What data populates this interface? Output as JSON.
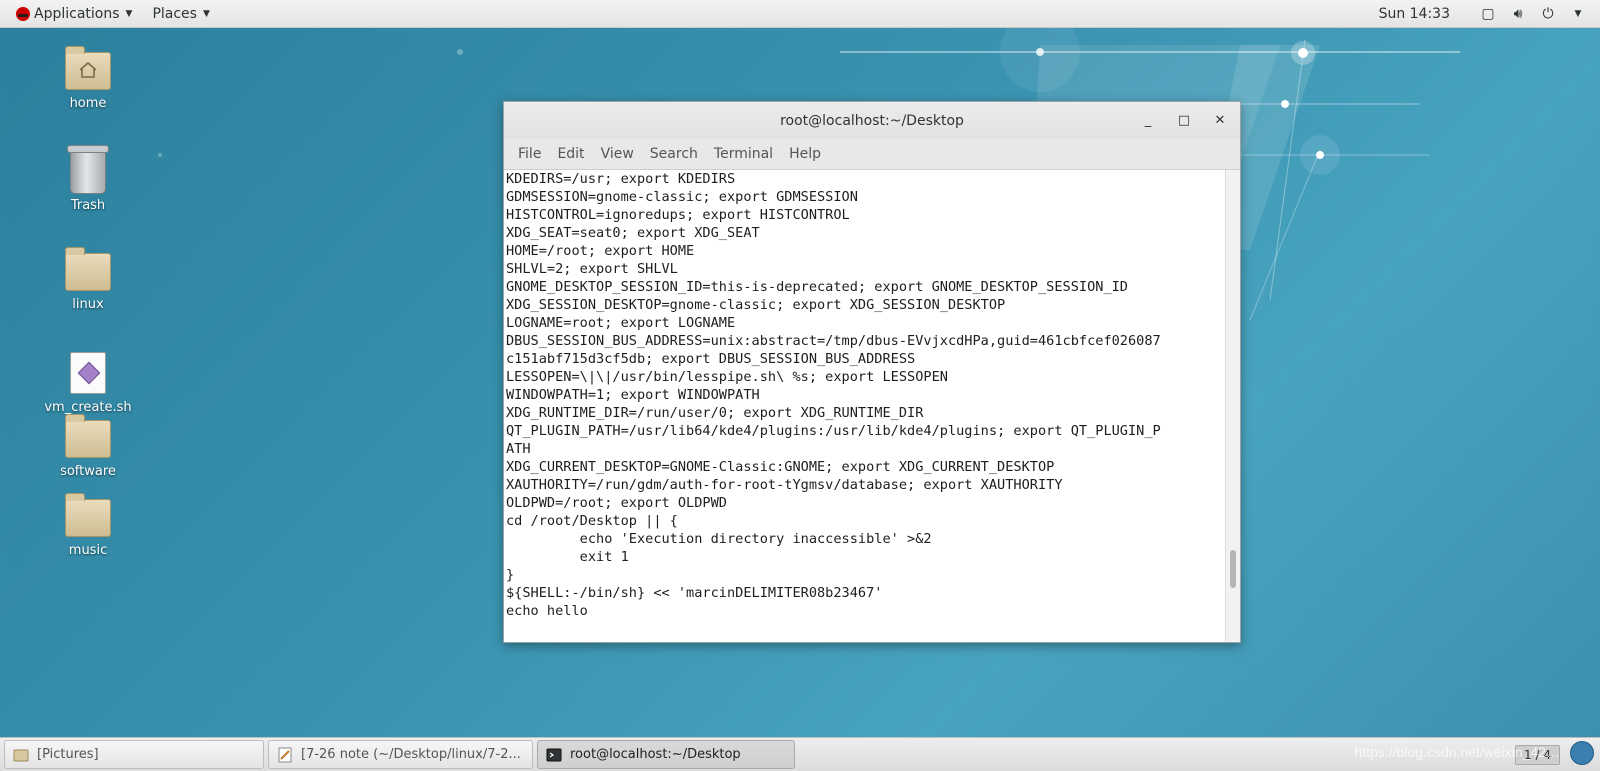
{
  "topbar": {
    "applications": "Applications",
    "places": "Places",
    "clock": "Sun 14:33"
  },
  "desktop": {
    "icons": [
      {
        "label": "home",
        "icon": "home-folder-icon"
      },
      {
        "label": "Trash",
        "icon": "trash-icon"
      },
      {
        "label": "linux",
        "icon": "folder-icon"
      },
      {
        "label": "vm_create.sh",
        "icon": "script-icon"
      },
      {
        "label": "software",
        "icon": "folder-icon"
      },
      {
        "label": "music",
        "icon": "folder-icon"
      }
    ]
  },
  "terminal": {
    "title": "root@localhost:~/Desktop",
    "menu": [
      "File",
      "Edit",
      "View",
      "Search",
      "Terminal",
      "Help"
    ],
    "lines": [
      "KDEDIRS=/usr; export KDEDIRS",
      "GDMSESSION=gnome-classic; export GDMSESSION",
      "HISTCONTROL=ignoredups; export HISTCONTROL",
      "XDG_SEAT=seat0; export XDG_SEAT",
      "HOME=/root; export HOME",
      "SHLVL=2; export SHLVL",
      "GNOME_DESKTOP_SESSION_ID=this-is-deprecated; export GNOME_DESKTOP_SESSION_ID",
      "XDG_SESSION_DESKTOP=gnome-classic; export XDG_SESSION_DESKTOP",
      "LOGNAME=root; export LOGNAME",
      "DBUS_SESSION_BUS_ADDRESS=unix:abstract=/tmp/dbus-EVvjxcdHPa,guid=461cbfcef026087",
      "c151abf715d3cf5db; export DBUS_SESSION_BUS_ADDRESS",
      "LESSOPEN=\\|\\|/usr/bin/lesspipe.sh\\ %s; export LESSOPEN",
      "WINDOWPATH=1; export WINDOWPATH",
      "XDG_RUNTIME_DIR=/run/user/0; export XDG_RUNTIME_DIR",
      "QT_PLUGIN_PATH=/usr/lib64/kde4/plugins:/usr/lib/kde4/plugins; export QT_PLUGIN_P",
      "ATH",
      "XDG_CURRENT_DESKTOP=GNOME-Classic:GNOME; export XDG_CURRENT_DESKTOP",
      "XAUTHORITY=/run/gdm/auth-for-root-tYgmsv/database; export XAUTHORITY",
      "OLDPWD=/root; export OLDPWD",
      "cd /root/Desktop || {",
      "         echo 'Execution directory inaccessible' >&2",
      "         exit 1",
      "}",
      "${SHELL:-/bin/sh} << 'marcinDELIMITER08b23467'",
      "echo hello"
    ]
  },
  "taskbar": {
    "items": [
      {
        "label": "[Pictures]"
      },
      {
        "label": "[7-26 note (~/Desktop/linux/7-2..."
      },
      {
        "label": "root@localhost:~/Desktop"
      }
    ],
    "pager": "1 / 4",
    "watermark": "https://blog.csdn.net/weixin_42…"
  }
}
